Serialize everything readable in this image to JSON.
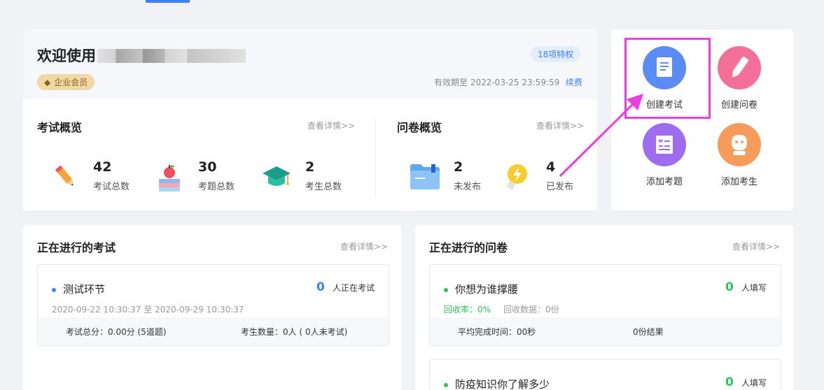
{
  "welcome": {
    "title": "欢迎使用",
    "badge": "企业会员",
    "privileges": "18项特权",
    "expiry": "有效期至 2022-03-25 23:59:59",
    "renew": "续费"
  },
  "exam_overview": {
    "title": "考试概览",
    "more": "查看详情>>",
    "stats": [
      {
        "value": "42",
        "label": "考试总数",
        "icon": "pencil-icon"
      },
      {
        "value": "30",
        "label": "考题总数",
        "icon": "books-apple-icon"
      },
      {
        "value": "2",
        "label": "考生总数",
        "icon": "graduation-cap-icon"
      }
    ]
  },
  "survey_overview": {
    "title": "问卷概览",
    "more": "查看详情>>",
    "stats": [
      {
        "value": "2",
        "label": "未发布",
        "icon": "folder-icon"
      },
      {
        "value": "4",
        "label": "已发布",
        "icon": "lightbulb-icon"
      }
    ]
  },
  "quick_actions": [
    {
      "label": "创建考试",
      "icon": "document-icon",
      "color": "#5b8cf5",
      "highlighted": true
    },
    {
      "label": "创建问卷",
      "icon": "pen-icon",
      "color": "#f46f9a"
    },
    {
      "label": "添加考题",
      "icon": "checklist-icon",
      "color": "#9f6cf0"
    },
    {
      "label": "添加考生",
      "icon": "person-icon",
      "color": "#f79b5b"
    }
  ],
  "ongoing_exams": {
    "title": "正在进行的考试",
    "more": "查看详情>>",
    "items": [
      {
        "name": "测试环节",
        "count": "0",
        "count_label": "人正在考试",
        "period": "2020-09-22 10:30:37 至 2020-09-29 10:30:37",
        "score": "考试总分：0.00分 (5道题)",
        "takers": "考生数量：0人 ( 0人未考试)"
      }
    ]
  },
  "ongoing_surveys": {
    "title": "正在进行的问卷",
    "more": "查看详情>>",
    "items": [
      {
        "name": "你想为谁撑腰",
        "count": "0",
        "count_label": "人填写",
        "rate": "回收率：0%",
        "data": "回收数据：0份",
        "avg_time": "平均完成时间：00秒",
        "extra": "0份结果"
      },
      {
        "name": "防疫知识你了解多少",
        "count": "0",
        "count_label": "人填写"
      }
    ]
  },
  "colors": {
    "accent": "#3b82f6",
    "green": "#2cc55a",
    "highlight": "#e83ee3"
  }
}
